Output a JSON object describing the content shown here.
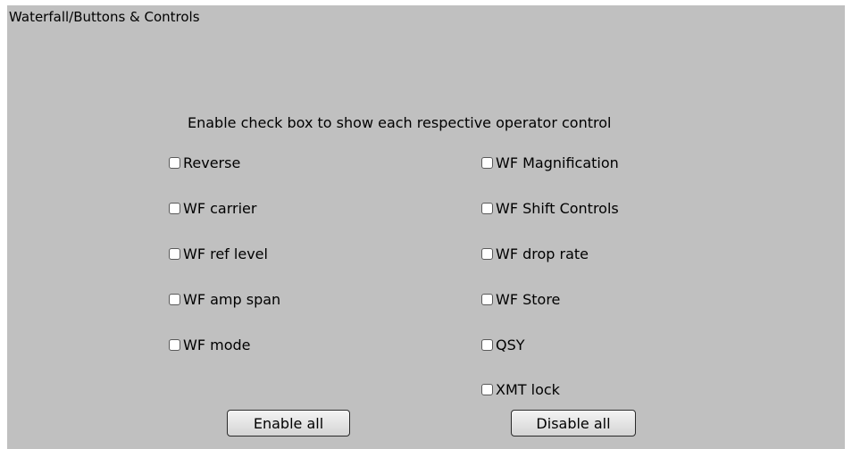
{
  "panel": {
    "title": "Waterfall/Buttons & Controls",
    "instructions": "Enable check box to show each respective operator control"
  },
  "checkboxes": {
    "left": [
      {
        "label": "Reverse",
        "checked": false
      },
      {
        "label": "WF carrier",
        "checked": false
      },
      {
        "label": "WF ref level",
        "checked": false
      },
      {
        "label": "WF amp span",
        "checked": false
      },
      {
        "label": "WF mode",
        "checked": false
      }
    ],
    "right": [
      {
        "label": "WF Magnification",
        "checked": false
      },
      {
        "label": "WF Shift Controls",
        "checked": false
      },
      {
        "label": "WF drop rate",
        "checked": false
      },
      {
        "label": "WF Store",
        "checked": false
      },
      {
        "label": "QSY",
        "checked": false
      },
      {
        "label": "XMT lock",
        "checked": false
      }
    ]
  },
  "buttons": {
    "enable_all": "Enable all",
    "disable_all": "Disable all"
  },
  "colors": {
    "panel_background": "#c0c0c0",
    "page_background": "#ffffff"
  }
}
